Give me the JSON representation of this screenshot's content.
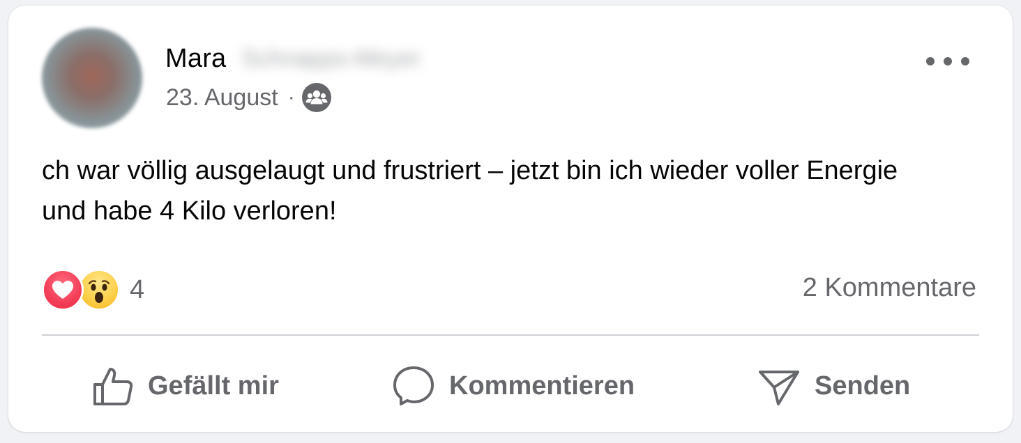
{
  "post": {
    "author": {
      "first_name": "Mara",
      "surname_redacted": "Schnapps-Meyer"
    },
    "date": "23. August",
    "separator": "·",
    "audience_icon": "friends-icon",
    "text": "ch war völlig ausgelaugt und frustriert – jetzt bin ich wieder voller Energie und habe 4 Kilo verloren!",
    "reactions": {
      "types": [
        "love",
        "wow"
      ],
      "count": "4",
      "colors": {
        "love": "#f33e58",
        "wow": "#fcd04a"
      }
    },
    "comments_label": "2 Kommentare"
  },
  "actions": {
    "like_label": "Gefällt mir",
    "comment_label": "Kommentieren",
    "send_label": "Senden"
  },
  "theme": {
    "secondary_text": "#65676b",
    "primary_text": "#050505",
    "divider": "#ced0d4"
  }
}
